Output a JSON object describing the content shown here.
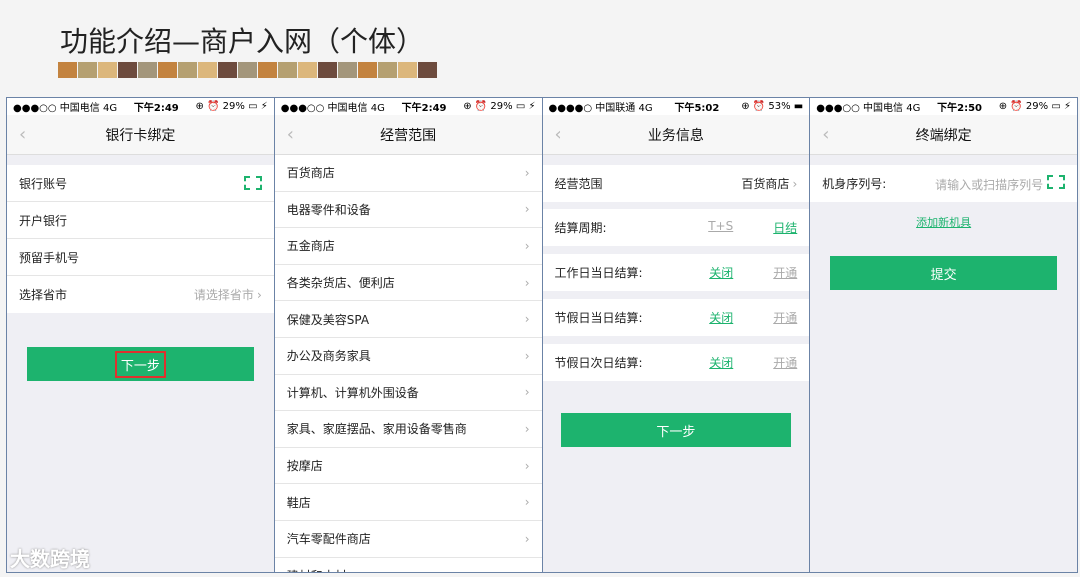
{
  "slide_title": "功能介绍—商户入网（个体）",
  "deco_colors": [
    "#c3833f",
    "#b5a071",
    "#dcb77c",
    "#6d4b3e",
    "#a3967b",
    "#c3833f",
    "#b5a071",
    "#dcb77c",
    "#6d4b3e",
    "#a3967b",
    "#c3833f",
    "#b5a071",
    "#dcb77c",
    "#6d4b3e",
    "#a3967b",
    "#c3833f",
    "#b5a071",
    "#dcb77c",
    "#6d4b3e"
  ],
  "accent": "#1db36e",
  "screens": {
    "bank": {
      "status": {
        "left": "●●●○○ 中国电信  4G",
        "time": "下午2:49",
        "right": "⊕ ⏰ 29% ▭ ⚡"
      },
      "title": "银行卡绑定",
      "account_label": "银行账号",
      "bank_label": "开户银行",
      "phone_label": "预留手机号",
      "province_label": "选择省市",
      "province_placeholder": "请选择省市",
      "next": "下一步"
    },
    "scope": {
      "status": {
        "left": "●●●○○ 中国电信  4G",
        "time": "下午2:49",
        "right": "⊕ ⏰ 29% ▭ ⚡"
      },
      "title": "经营范围",
      "items": [
        "百货商店",
        "电器零件和设备",
        "五金商店",
        "各类杂货店、便利店",
        "保健及美容SPA",
        "办公及商务家具",
        "计算机、计算机外围设备",
        "家具、家庭摆品、家用设备零售商",
        "按摩店",
        "鞋店",
        "汽车零配件商店",
        "建材和木材"
      ]
    },
    "biz": {
      "status": {
        "left": "●●●●○ 中国联通  4G",
        "time": "下午5:02",
        "right": "⊕ ⏰ 53% ▬"
      },
      "title": "业务信息",
      "scope_label": "经营范围",
      "scope_value": "百货商店",
      "cycle_label": "结算周期:",
      "cycle_t": "T+S",
      "cycle_d": "日结",
      "work_label": "工作日当日结算:",
      "holiday_label": "节假日当日结算:",
      "holiday_next_label": "节假日次日结算:",
      "off": "关闭",
      "on": "开通",
      "next": "下一步"
    },
    "terminal": {
      "status": {
        "left": "●●●○○ 中国电信  4G",
        "time": "下午2:50",
        "right": "⊕ ⏰ 29% ▭ ⚡"
      },
      "title": "终端绑定",
      "serial_label": "机身序列号:",
      "serial_placeholder": "请输入或扫描序列号",
      "add_link": "添加新机具",
      "submit": "提交"
    }
  },
  "watermark": "大数跨境"
}
